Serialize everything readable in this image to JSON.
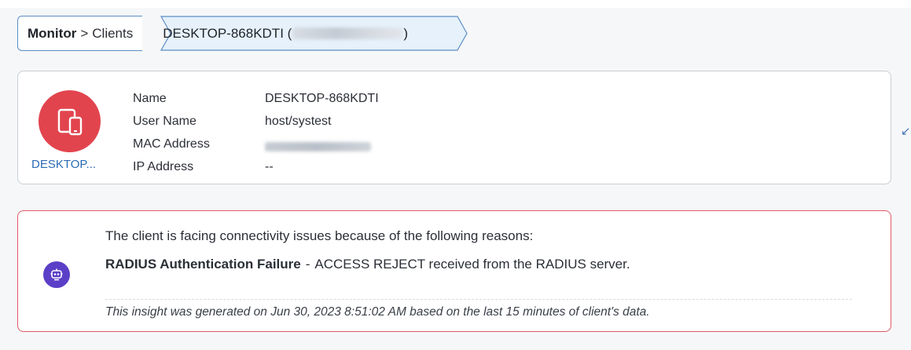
{
  "breadcrumb": {
    "root": "Monitor",
    "separator": ">",
    "section": "Clients",
    "current_prefix": "DESKTOP-868KDTI (",
    "current_suffix": ")"
  },
  "client": {
    "avatar_caption": "DESKTOP...",
    "avatar_color": "#e2444e",
    "avatar_icon": "mobile-devices-icon",
    "fields": [
      {
        "label": "Name",
        "value": "DESKTOP-868KDTI"
      },
      {
        "label": "User Name",
        "value": "host/systest"
      },
      {
        "label": "MAC Address",
        "value": ""
      },
      {
        "label": "IP Address",
        "value": "--"
      }
    ]
  },
  "insight": {
    "icon": "robot-icon",
    "intro": "The client is facing connectivity issues because of the following reasons:",
    "reason_title": "RADIUS Authentication Failure",
    "reason_dash": "-",
    "reason_detail": "ACCESS REJECT received from the RADIUS server.",
    "footer": "This insight was generated on Jun 30, 2023 8:51:02 AM based on the last 15 minutes of client's data.",
    "border_color": "#e05b66",
    "icon_color": "#5b3fc7"
  }
}
